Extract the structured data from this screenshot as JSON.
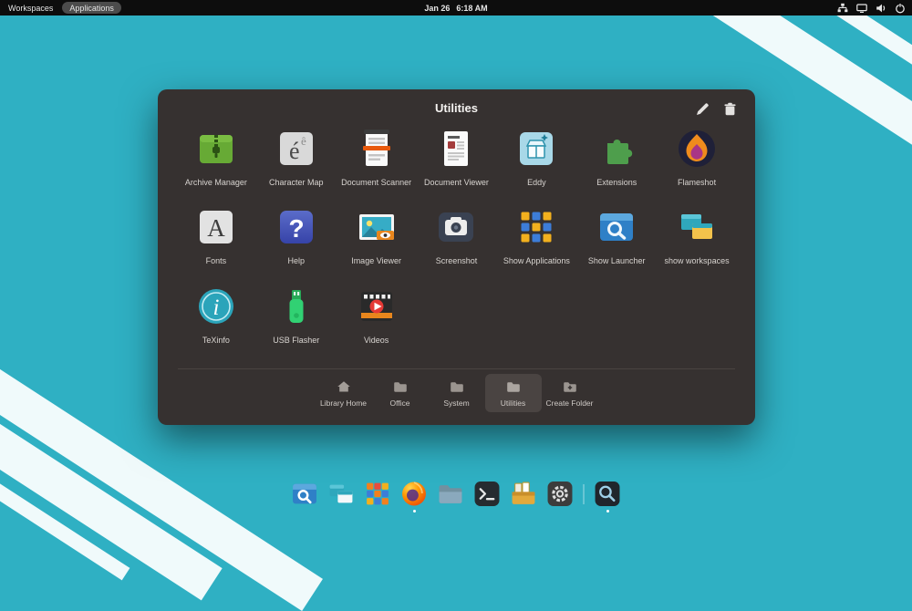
{
  "topbar": {
    "workspaces_label": "Workspaces",
    "applications_label": "Applications",
    "clock_date": "Jan 26",
    "clock_time": "6:18 AM",
    "tray_icons": [
      "network-icon",
      "display-icon",
      "volume-icon",
      "power-icon"
    ]
  },
  "dialog": {
    "title": "Utilities",
    "action_icons": [
      "pencil-icon",
      "trash-icon"
    ],
    "apps": [
      {
        "name": "Archive Manager",
        "icon": "archive-manager-icon"
      },
      {
        "name": "Character Map",
        "icon": "character-map-icon"
      },
      {
        "name": "Document Scanner",
        "icon": "document-scanner-icon"
      },
      {
        "name": "Document Viewer",
        "icon": "document-viewer-icon"
      },
      {
        "name": "Eddy",
        "icon": "eddy-icon"
      },
      {
        "name": "Extensions",
        "icon": "extensions-icon"
      },
      {
        "name": "Flameshot",
        "icon": "flameshot-icon"
      },
      {
        "name": "Fonts",
        "icon": "fonts-icon"
      },
      {
        "name": "Help",
        "icon": "help-icon"
      },
      {
        "name": "Image Viewer",
        "icon": "image-viewer-icon"
      },
      {
        "name": "Screenshot",
        "icon": "screenshot-icon"
      },
      {
        "name": "Show Applications",
        "icon": "show-applications-icon"
      },
      {
        "name": "Show Launcher",
        "icon": "show-launcher-icon"
      },
      {
        "name": "show workspaces",
        "icon": "show-workspaces-icon"
      },
      {
        "name": "TeXinfo",
        "icon": "texinfo-icon"
      },
      {
        "name": "USB Flasher",
        "icon": "usb-flasher-icon"
      },
      {
        "name": "Videos",
        "icon": "videos-icon"
      }
    ],
    "tabs": [
      {
        "label": "Library Home",
        "icon": "home-icon",
        "active": false
      },
      {
        "label": "Office",
        "icon": "folder-icon",
        "active": false
      },
      {
        "label": "System",
        "icon": "folder-icon",
        "active": false
      },
      {
        "label": "Utilities",
        "icon": "folder-icon",
        "active": true
      },
      {
        "label": "Create Folder",
        "icon": "new-folder-icon",
        "active": false
      }
    ]
  },
  "dock": {
    "items": [
      {
        "icon": "show-launcher-icon",
        "running": false
      },
      {
        "icon": "show-workspaces-icon",
        "running": false
      },
      {
        "icon": "show-applications-icon",
        "running": false
      },
      {
        "icon": "firefox-icon",
        "running": true
      },
      {
        "icon": "files-icon",
        "running": false
      },
      {
        "icon": "terminal-icon",
        "running": false
      },
      {
        "icon": "documents-icon",
        "running": false
      },
      {
        "icon": "settings-icon",
        "running": false
      },
      {
        "icon": "screenshot-tool-icon",
        "running": true
      }
    ]
  },
  "colors": {
    "desktop": "#2fb0c3",
    "panel": "#0d0d0d",
    "dialog": "#363130",
    "active_tab": "#4a4442",
    "stripe": "#ffffff"
  }
}
